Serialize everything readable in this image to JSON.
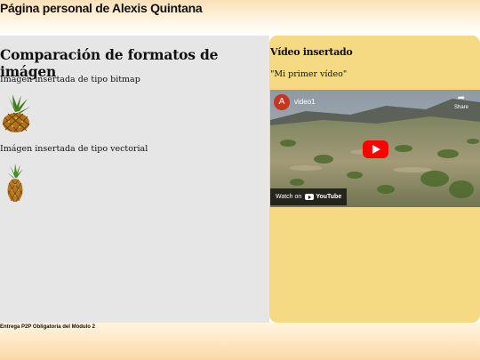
{
  "header": {
    "title": "Página personal de Alexis Quintana"
  },
  "main": {
    "heading": "Comparación de formatos de imágen",
    "bitmap_caption": "Imágen insertada de tipo bitmap",
    "vector_caption": "Imágen insertada de tipo vectorial",
    "bitmap_image_icon": "pineapple-icon",
    "vector_image_icon": "pineapple-icon"
  },
  "sidebar": {
    "heading": "Vídeo insertado",
    "quote": "\"Mi primer vídeo\"",
    "video": {
      "channel_initial": "A",
      "title": "video1",
      "share_label": "Share",
      "watch_on_label": "Watch on",
      "platform_label": "YouTube"
    }
  },
  "footer": {
    "text": "Entrega P2P Obligatoria del Módulo 2"
  },
  "colors": {
    "sidebar_bg": "#f5da83",
    "main_bg": "#e6e6e6",
    "header_gradient_top": "#fbe1b8",
    "play_button": "#ff0000"
  }
}
